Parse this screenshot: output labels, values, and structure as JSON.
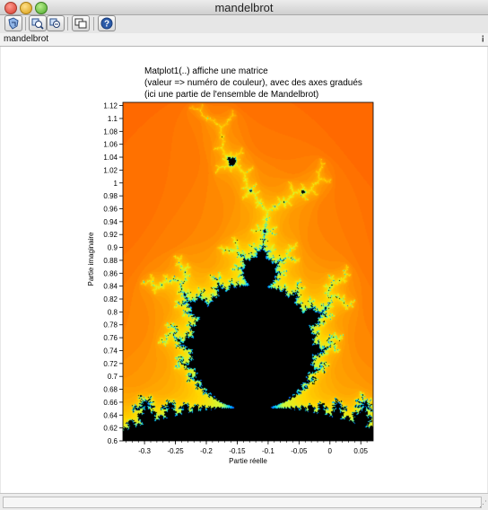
{
  "window": {
    "title": "mandelbrot"
  },
  "toolbar": {
    "buttons": [
      {
        "name": "rotate-button",
        "icon": "rotate-icon"
      },
      {
        "name": "zoom-button",
        "icon": "zoom-in-icon"
      },
      {
        "name": "unzoom-button",
        "icon": "zoom-out-icon"
      },
      {
        "name": "select-figure-button",
        "icon": "windows-icon"
      },
      {
        "name": "help-button",
        "icon": "help-icon"
      }
    ]
  },
  "tab": {
    "label": "mandelbrot",
    "undock_glyph": "¡"
  },
  "plot": {
    "caption_lines": [
      "Matplot1(..) affiche une matrice",
      "(valeur => numéro de couleur), avec des axes gradués",
      "(ici une partie de l'ensemble de Mandelbrot)"
    ]
  },
  "chart_data": {
    "type": "heatmap",
    "title": "",
    "xlabel": "Partie réelle",
    "ylabel": "Partie imaginaire",
    "xlim": [
      -0.335,
      0.07
    ],
    "ylim": [
      0.6,
      1.125
    ],
    "x_ticks": [
      -0.3,
      -0.25,
      -0.2,
      -0.15,
      -0.1,
      -0.05,
      0,
      0.05
    ],
    "x_tick_labels": [
      "-0.3",
      "-0.25",
      "-0.2",
      "-0.15",
      "-0.1",
      "-0.05",
      "0",
      "0.05"
    ],
    "y_ticks": [
      0.6,
      0.62,
      0.64,
      0.66,
      0.68,
      0.7,
      0.72,
      0.74,
      0.76,
      0.78,
      0.8,
      0.82,
      0.84,
      0.86,
      0.88,
      0.9,
      0.92,
      0.94,
      0.96,
      0.98,
      1,
      1.02,
      1.04,
      1.06,
      1.08,
      1.1,
      1.12
    ],
    "y_tick_labels": [
      "0.6",
      "0.62",
      "0.64",
      "0.66",
      "0.68",
      "0.7",
      "0.72",
      "0.74",
      "0.76",
      "0.78",
      "0.8",
      "0.82",
      "0.84",
      "0.86",
      "0.88",
      "0.9",
      "0.92",
      "0.94",
      "0.96",
      "0.98",
      "1",
      "1.02",
      "1.04",
      "1.06",
      "1.08",
      "1.1",
      "1.12"
    ],
    "max_iter": 60,
    "colors": {
      "set": "#000000",
      "far": "#ff2e00",
      "mid": "#ff7d00",
      "near": "#ffd800",
      "edge1": "#c8ff40",
      "edge2": "#00e0ff",
      "edge3": "#0050ff"
    },
    "grid": false,
    "legend": "none"
  }
}
